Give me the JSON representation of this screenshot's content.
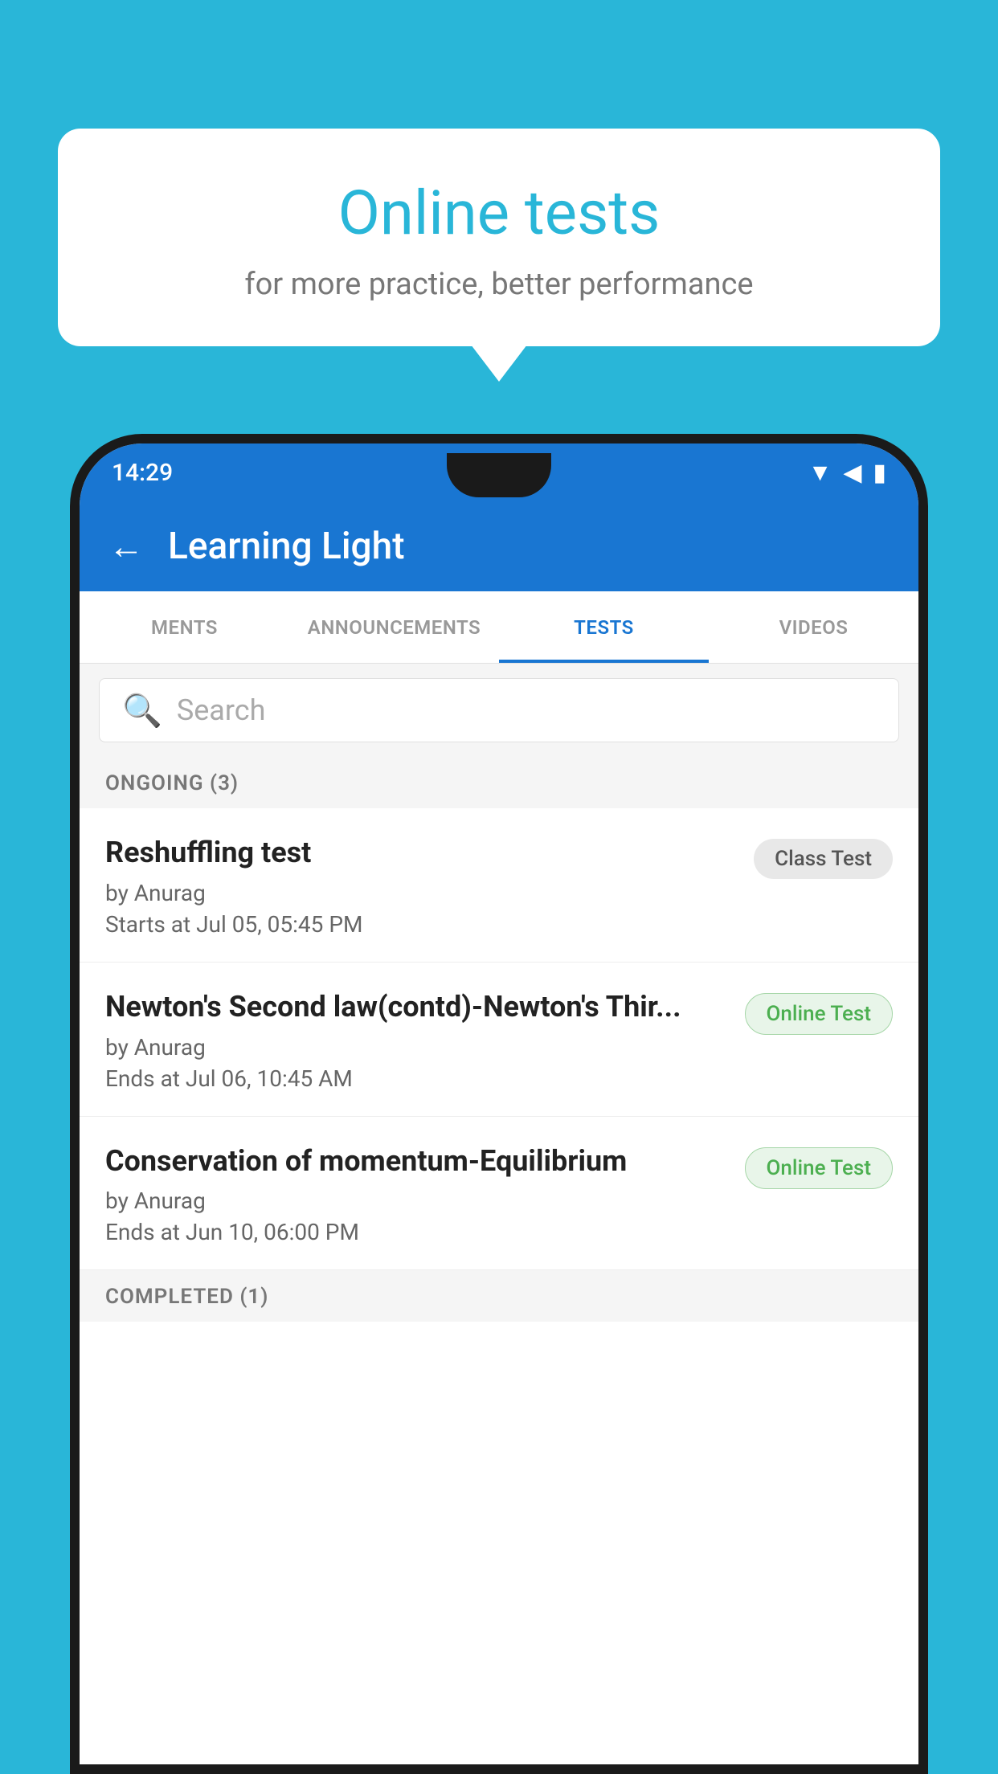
{
  "background_color": "#29b6d8",
  "bubble": {
    "title": "Online tests",
    "subtitle": "for more practice, better performance"
  },
  "phone": {
    "status_bar": {
      "time": "14:29",
      "icons": [
        "wifi",
        "signal",
        "battery"
      ]
    },
    "app_bar": {
      "title": "Learning Light",
      "back_label": "←"
    },
    "tabs": [
      {
        "label": "MENTS",
        "active": false
      },
      {
        "label": "ANNOUNCEMENTS",
        "active": false
      },
      {
        "label": "TESTS",
        "active": true
      },
      {
        "label": "VIDEOS",
        "active": false
      }
    ],
    "search": {
      "placeholder": "Search"
    },
    "ongoing_section": {
      "header": "ONGOING (3)",
      "items": [
        {
          "title": "Reshuffling test",
          "by": "by Anurag",
          "time": "Starts at  Jul 05, 05:45 PM",
          "badge": "Class Test",
          "badge_type": "class"
        },
        {
          "title": "Newton's Second law(contd)-Newton's Thir...",
          "by": "by Anurag",
          "time": "Ends at  Jul 06, 10:45 AM",
          "badge": "Online Test",
          "badge_type": "online"
        },
        {
          "title": "Conservation of momentum-Equilibrium",
          "by": "by Anurag",
          "time": "Ends at  Jun 10, 06:00 PM",
          "badge": "Online Test",
          "badge_type": "online"
        }
      ]
    },
    "completed_section": {
      "header": "COMPLETED (1)"
    }
  }
}
